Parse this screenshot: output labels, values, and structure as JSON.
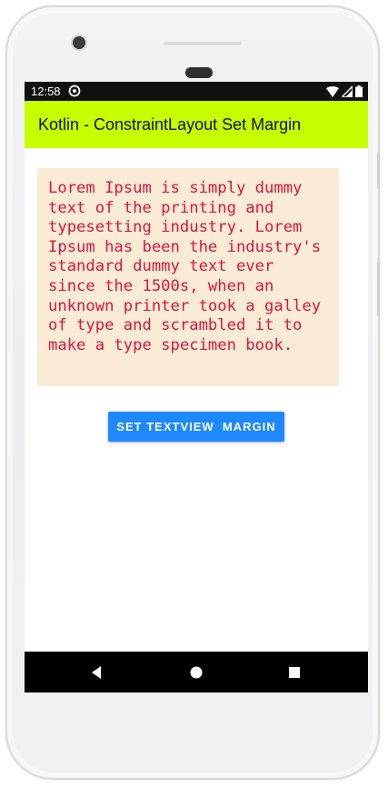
{
  "status_bar": {
    "time": "12:58",
    "icons": [
      "sync-icon",
      "wifi-icon",
      "signal-icon",
      "battery-icon"
    ]
  },
  "app_bar": {
    "title": "Kotlin - ConstraintLayout Set Margin",
    "color": "#c6ff00"
  },
  "main": {
    "lorem_text": "Lorem Ipsum is simply dummy text of the printing and typesetting industry. Lorem Ipsum has been the industry's standard dummy text ever since the 1500s, when an unknown printer took a galley of type and scrambled it to make a type specimen book.",
    "text_color": "#dc143c",
    "box_background": "#faebd7",
    "button_label": "SET TEXTVIEW  MARGIN",
    "button_color": "#1e88ff"
  },
  "nav_bar": {
    "icons": [
      "back-icon",
      "home-icon",
      "recents-icon"
    ]
  }
}
